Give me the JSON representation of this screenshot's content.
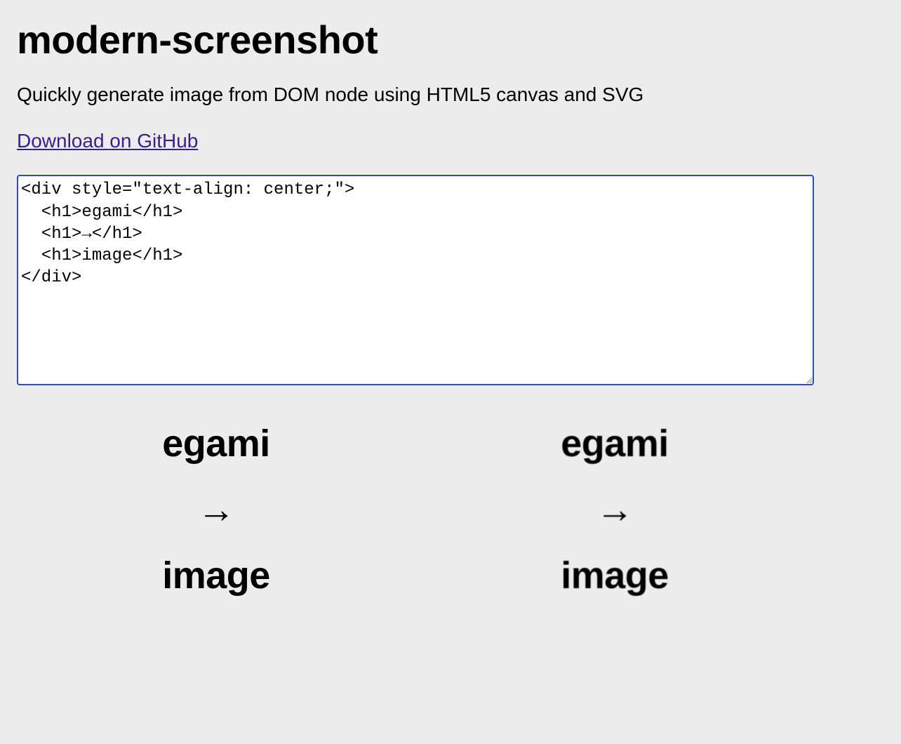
{
  "header": {
    "title": "modern-screenshot",
    "subtitle": "Quickly generate image from DOM node using HTML5 canvas and SVG",
    "github_link_label": "Download on GitHub"
  },
  "editor": {
    "value": "<div style=\"text-align: center;\">\n  <h1>egami</h1>\n  <h1>→</h1>\n  <h1>image</h1>\n</div>"
  },
  "preview": {
    "line1": "egami",
    "line2": "→",
    "line3": "image"
  }
}
